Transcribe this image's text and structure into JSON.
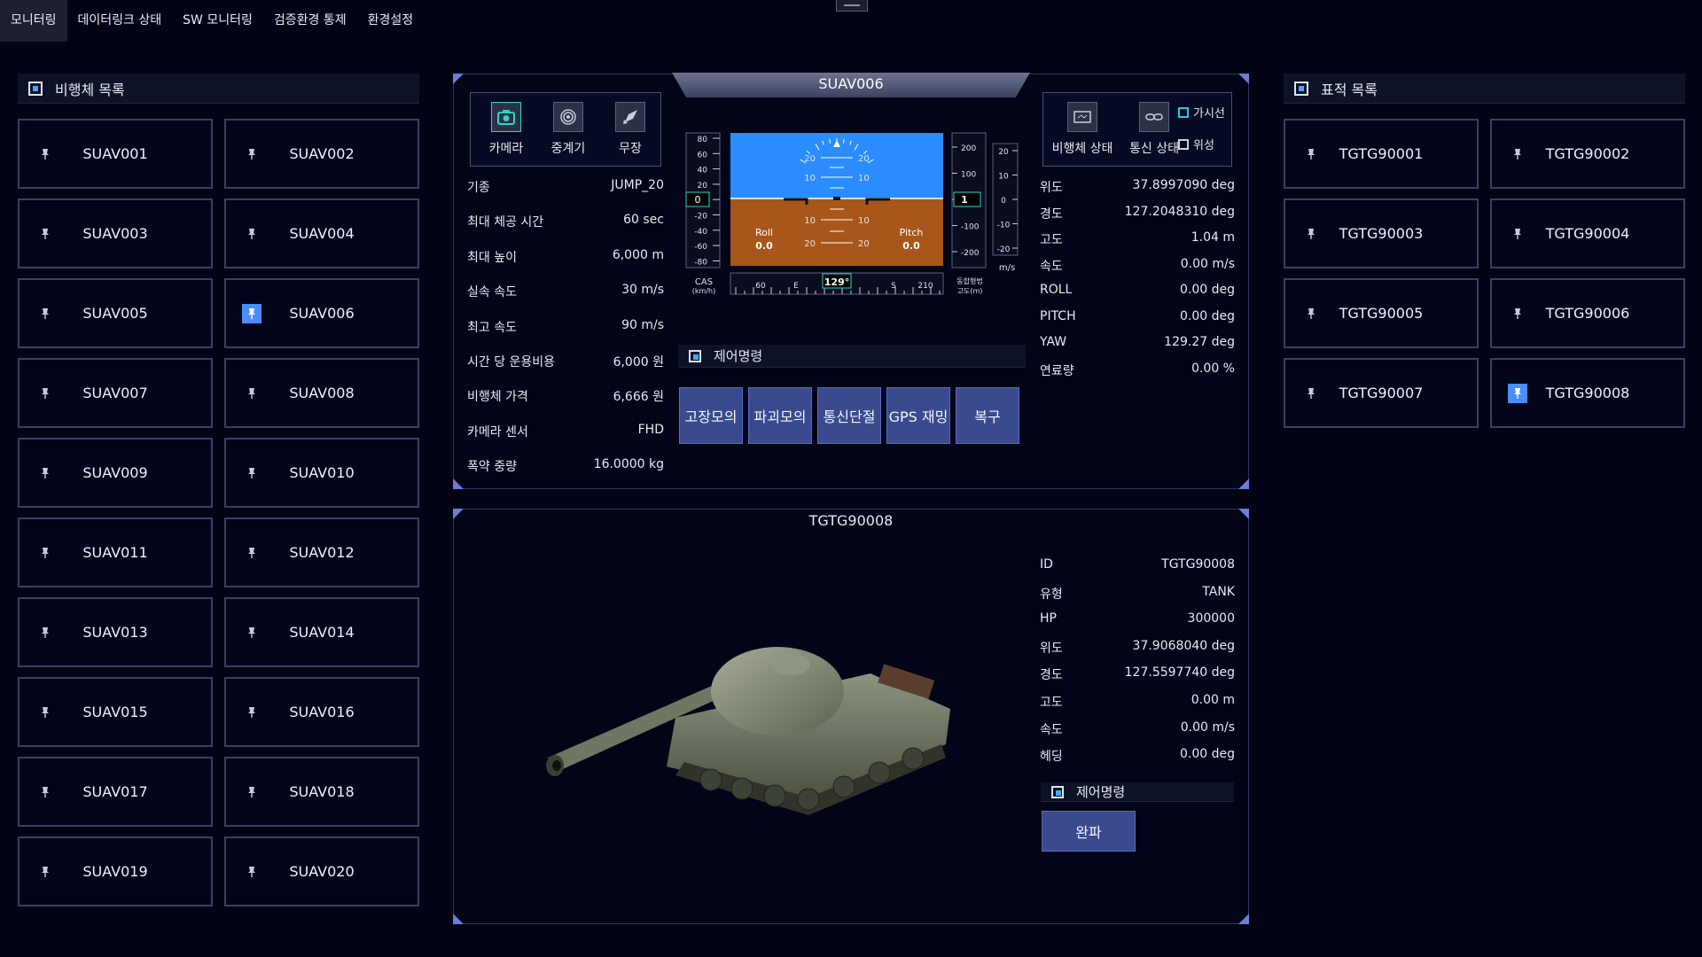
{
  "menu": [
    "모니터링",
    "데이터링크 상태",
    "SW 모니터링",
    "검증환경 통제",
    "환경설정"
  ],
  "uav_list": {
    "title": "비행체 목록",
    "items": [
      "SUAV001",
      "SUAV002",
      "SUAV003",
      "SUAV004",
      "SUAV005",
      "SUAV006",
      "SUAV007",
      "SUAV008",
      "SUAV009",
      "SUAV010",
      "SUAV011",
      "SUAV012",
      "SUAV013",
      "SUAV014",
      "SUAV015",
      "SUAV016",
      "SUAV017",
      "SUAV018",
      "SUAV019",
      "SUAV020"
    ],
    "selected": "SUAV006"
  },
  "target_list": {
    "title": "표적 목록",
    "items": [
      "TGTG90001",
      "TGTG90002",
      "TGTG90003",
      "TGTG90004",
      "TGTG90005",
      "TGTG90006",
      "TGTG90007",
      "TGTG90008"
    ],
    "selected": "TGTG90008"
  },
  "uav_panel": {
    "title": "SUAV006",
    "tools": [
      "카메라",
      "중계기",
      "무장"
    ],
    "specs": [
      {
        "k": "기종",
        "v": "JUMP_20"
      },
      {
        "k": "최대 체공 시간",
        "v": "60 sec"
      },
      {
        "k": "최대 높이",
        "v": "6,000 m"
      },
      {
        "k": "실속 속도",
        "v": "30 m/s"
      },
      {
        "k": "최고 속도",
        "v": "90 m/s"
      },
      {
        "k": "시간 당 운용비용",
        "v": "6,000 원"
      },
      {
        "k": "비행체 가격",
        "v": "6,666 원"
      },
      {
        "k": "카메라 센서",
        "v": "FHD"
      },
      {
        "k": "폭약 중량",
        "v": "16.0000 kg"
      }
    ],
    "status_tools": [
      "비행체 상태",
      "통신 상태"
    ],
    "view_options": [
      {
        "label": "가시선",
        "checked": true
      },
      {
        "label": "위성",
        "checked": false
      }
    ],
    "status": [
      {
        "k": "위도",
        "v": "37.8997090 deg"
      },
      {
        "k": "경도",
        "v": "127.2048310 deg"
      },
      {
        "k": "고도",
        "v": "1.04 m"
      },
      {
        "k": "속도",
        "v": "0.00 m/s"
      },
      {
        "k": "ROLL",
        "v": "0.00 deg"
      },
      {
        "k": "PITCH",
        "v": "0.00 deg"
      },
      {
        "k": "YAW",
        "v": "129.27 deg"
      },
      {
        "k": "연료량",
        "v": "0.00 %"
      }
    ],
    "control_title": "제어명령",
    "commands": [
      "고장모의",
      "파괴모의",
      "통신단절",
      "GPS 재밍",
      "복구"
    ],
    "pfd": {
      "cas_ticks": [
        "80",
        "60",
        "40",
        "20",
        "0",
        "-20",
        "-40",
        "-60",
        "-80"
      ],
      "cas_value": "0",
      "cas_label": "CAS",
      "cas_unit": "(km/h)",
      "alt_ticks": [
        "200",
        "100",
        "0",
        "-100",
        "-200"
      ],
      "alt_value": "1",
      "alt_label": "동합형법",
      "alt_unit": "고도(m)",
      "vs_ticks": [
        "20",
        "10",
        "0",
        "-10",
        "-20"
      ],
      "vs_unit": "m/s",
      "pitch_marks": [
        "20",
        "10",
        "10",
        "20"
      ],
      "roll_label": "Roll",
      "roll_value": "0.0",
      "pitch_label": "Pitch",
      "pitch_value": "0.0",
      "heading_ticks": [
        "60",
        "E",
        "S",
        "210"
      ],
      "heading_value": "129°"
    }
  },
  "target_panel": {
    "title": "TGTG90008",
    "info": [
      {
        "k": "ID",
        "v": "TGTG90008"
      },
      {
        "k": "유형",
        "v": "TANK"
      },
      {
        "k": "HP",
        "v": "300000"
      },
      {
        "k": "위도",
        "v": "37.9068040 deg"
      },
      {
        "k": "경도",
        "v": "127.5597740 deg"
      },
      {
        "k": "고도",
        "v": "0.00 m"
      },
      {
        "k": "속도",
        "v": "0.00 m/s"
      },
      {
        "k": "헤딩",
        "v": "0.00 deg"
      }
    ],
    "control_title": "제어명령",
    "command": "완파"
  },
  "colors": {
    "accent": "#4a8dff",
    "sky": "#2a8cff",
    "ground": "#a8561a",
    "button": "#3a4a8e"
  }
}
